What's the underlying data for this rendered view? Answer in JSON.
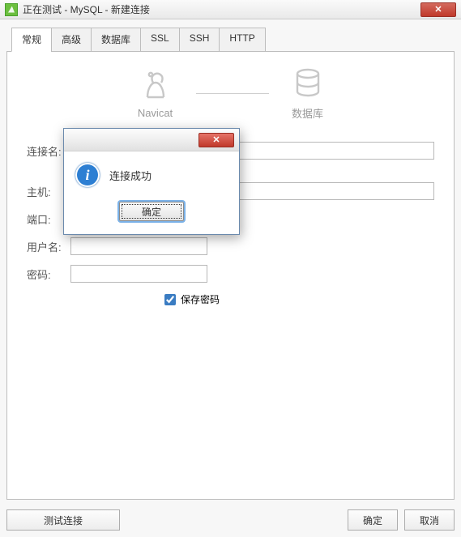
{
  "window": {
    "title": "正在测试 - MySQL - 新建连接"
  },
  "tabs": {
    "t0": "常规",
    "t1": "高级",
    "t2": "数据库",
    "t3": "SSL",
    "t4": "SSH",
    "t5": "HTTP"
  },
  "logos": {
    "left": "Navicat",
    "right": "数据库"
  },
  "form": {
    "name_label": "连接名:",
    "name_value": "",
    "host_label": "主机:",
    "host_value": "",
    "port_label": "端口:",
    "port_value": "",
    "user_label": "用户名:",
    "user_value": "",
    "pass_label": "密码:",
    "pass_value": "",
    "save_pass_label": "保存密码",
    "save_pass_checked": true
  },
  "footer": {
    "test": "测试连接",
    "ok": "确定",
    "cancel": "取消"
  },
  "modal": {
    "message": "连接成功",
    "ok": "确定"
  }
}
